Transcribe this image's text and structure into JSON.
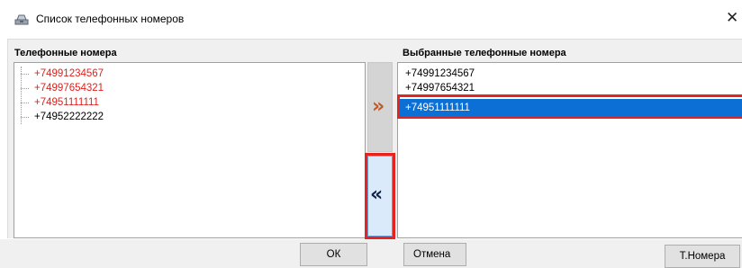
{
  "window": {
    "title": "Список телефонных номеров",
    "close_glyph": "✕",
    "icon": "phone-icon"
  },
  "left_panel": {
    "header": "Телефонные номера",
    "items": [
      {
        "number": "+74991234567",
        "color": "#e0201c"
      },
      {
        "number": "+74997654321",
        "color": "#e0201c"
      },
      {
        "number": "+74951111111",
        "color": "#e0201c"
      },
      {
        "number": "+74952222222",
        "color": "#000000"
      }
    ]
  },
  "right_panel": {
    "header": "Выбранные телефонные номера",
    "items": [
      {
        "number": "+74991234567",
        "selected": false
      },
      {
        "number": "+74997654321",
        "selected": false
      },
      {
        "number": "+74951111111",
        "selected": true
      }
    ],
    "selection_color": "#0b6fd6",
    "highlight_color": "#e5231f"
  },
  "transfer": {
    "add_glyph": "»",
    "remove_glyph": "«"
  },
  "buttons": {
    "ok": "ОК",
    "cancel": "Отмена",
    "numbers": "Т.Номера"
  }
}
